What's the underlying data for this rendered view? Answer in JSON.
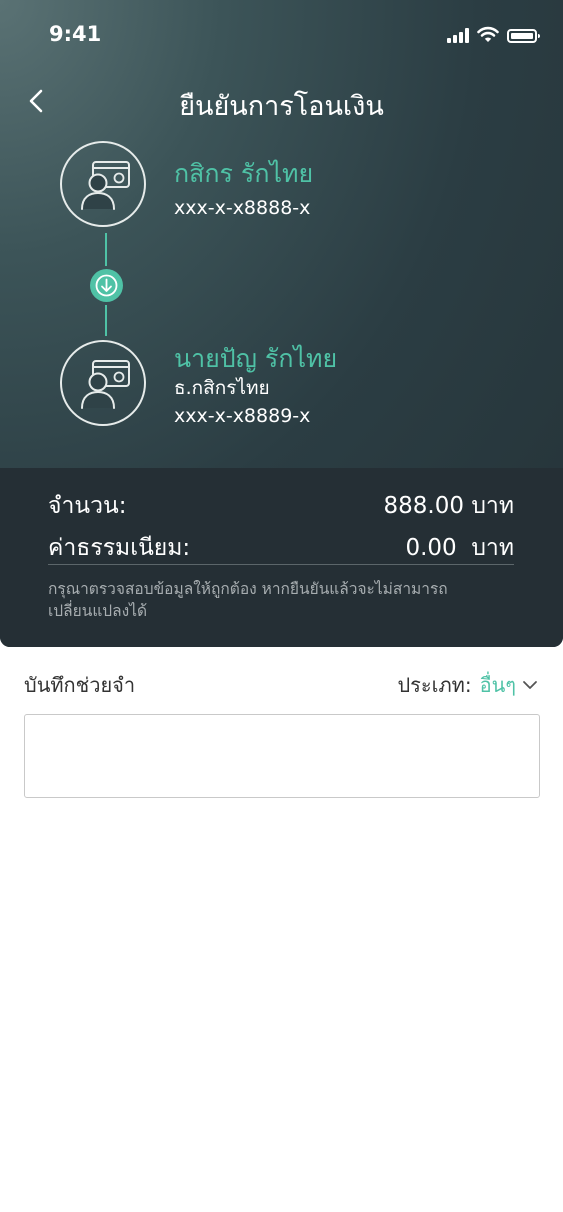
{
  "status_bar": {
    "time": "9:41",
    "icons": [
      "signal-icon",
      "wifi-icon",
      "battery-icon"
    ]
  },
  "header": {
    "title": "ยืนยันการโอนเงิน",
    "back_icon": "chevron-left-icon"
  },
  "sender": {
    "name": "กสิกร รักไทย",
    "account": "xxx-x-x8888-x",
    "icon": "user-card-icon"
  },
  "transfer_icon": "arrow-down-icon",
  "receiver": {
    "name": "นายปัญ รักไทย",
    "bank": "ธ.กสิกรไทย",
    "account": "xxx-x-x8889-x",
    "icon": "user-card-icon"
  },
  "summary": {
    "amount_label": "จำนวน:",
    "amount_value": "888.00 บาท",
    "fee_label": "ค่าธรรมเนียม:",
    "fee_value": "0.00  บาท",
    "note_line1": "กรุณาตรวจสอบข้อมูลให้ถูกต้อง หากยืนยันแล้วจะไม่สามารถ",
    "note_line2": "เปลี่ยนแปลงได้"
  },
  "memo": {
    "label": "บันทึกช่วยจำ",
    "type_label": "ประเภท:",
    "type_value": "อื่นๆ",
    "dropdown_icon": "chevron-down-icon",
    "input_value": ""
  },
  "colors": {
    "accent": "#4fc2a6",
    "header_dark": "#252f35",
    "header_gradient_light": "#5a7274"
  }
}
